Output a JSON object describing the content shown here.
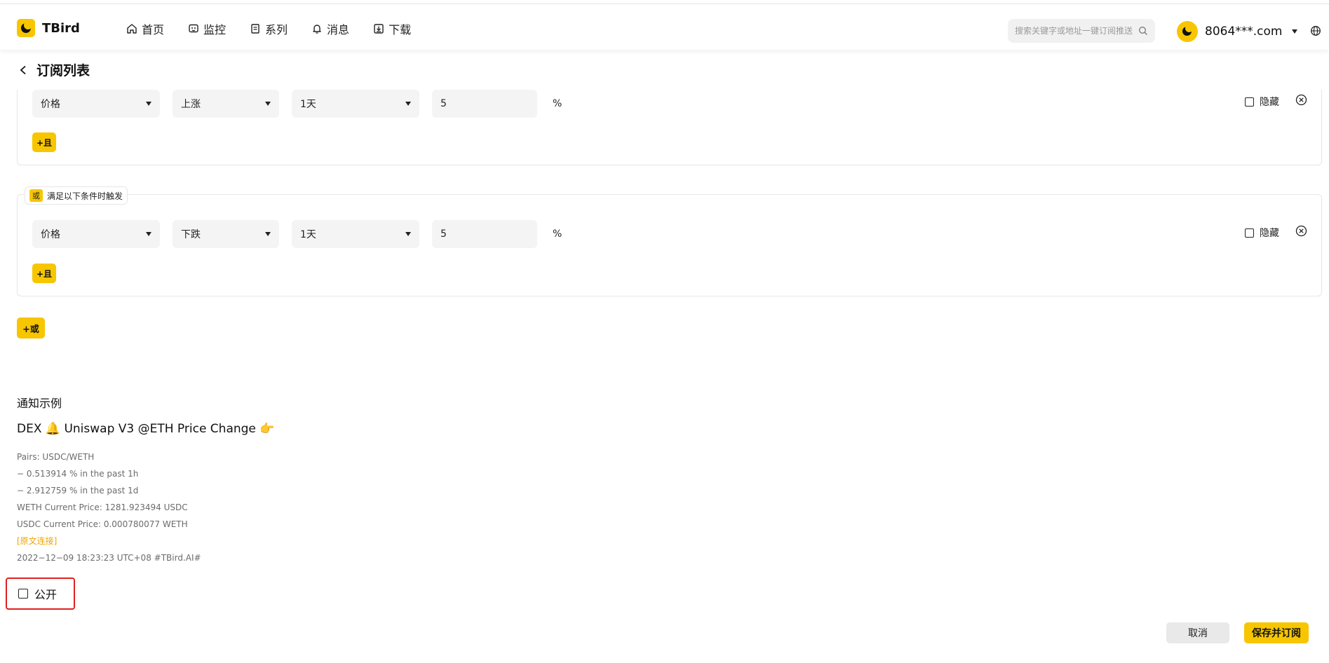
{
  "app": {
    "logo_text": "TBird"
  },
  "nav": {
    "items": [
      {
        "label": "首页",
        "icon": "home-icon"
      },
      {
        "label": "监控",
        "icon": "monitor-icon"
      },
      {
        "label": "系列",
        "icon": "series-icon"
      },
      {
        "label": "消息",
        "icon": "bell-icon"
      },
      {
        "label": "下载",
        "icon": "download-icon"
      }
    ]
  },
  "search": {
    "placeholder": "搜索关键字或地址一键订阅推送"
  },
  "user": {
    "name": "8064***.com"
  },
  "page": {
    "title": "订阅列表"
  },
  "groups": [
    {
      "metric": "价格",
      "direction": "上涨",
      "period": "1天",
      "value": "5",
      "unit": "%",
      "hide_label": "隐藏",
      "and_label": "+且"
    },
    {
      "legend_tag": "或",
      "legend_text": "满足以下条件时触发",
      "metric": "价格",
      "direction": "下跌",
      "period": "1天",
      "value": "5",
      "unit": "%",
      "hide_label": "隐藏",
      "and_label": "+且"
    }
  ],
  "or_button": "+或",
  "notice": {
    "title": "通知示例",
    "headline": "DEX 🔔 Uniswap V3 @ETH Price Change 👉",
    "lines": [
      "Pairs: USDC/WETH",
      "− 0.513914 % in the past 1h",
      "− 2.912759 % in the past 1d",
      "WETH Current Price: 1281.923494 USDC",
      "USDC Current Price: 0.000780077 WETH"
    ],
    "link": "[原文连接]",
    "footer": "2022−12−09 18:23:23 UTC+08  #TBird.AI#"
  },
  "public_label": "公开",
  "buttons": {
    "cancel": "取消",
    "save": "保存并订阅"
  },
  "colors": {
    "accent": "#f7c600",
    "highlight_border": "#e02020",
    "link": "#f0a500"
  }
}
